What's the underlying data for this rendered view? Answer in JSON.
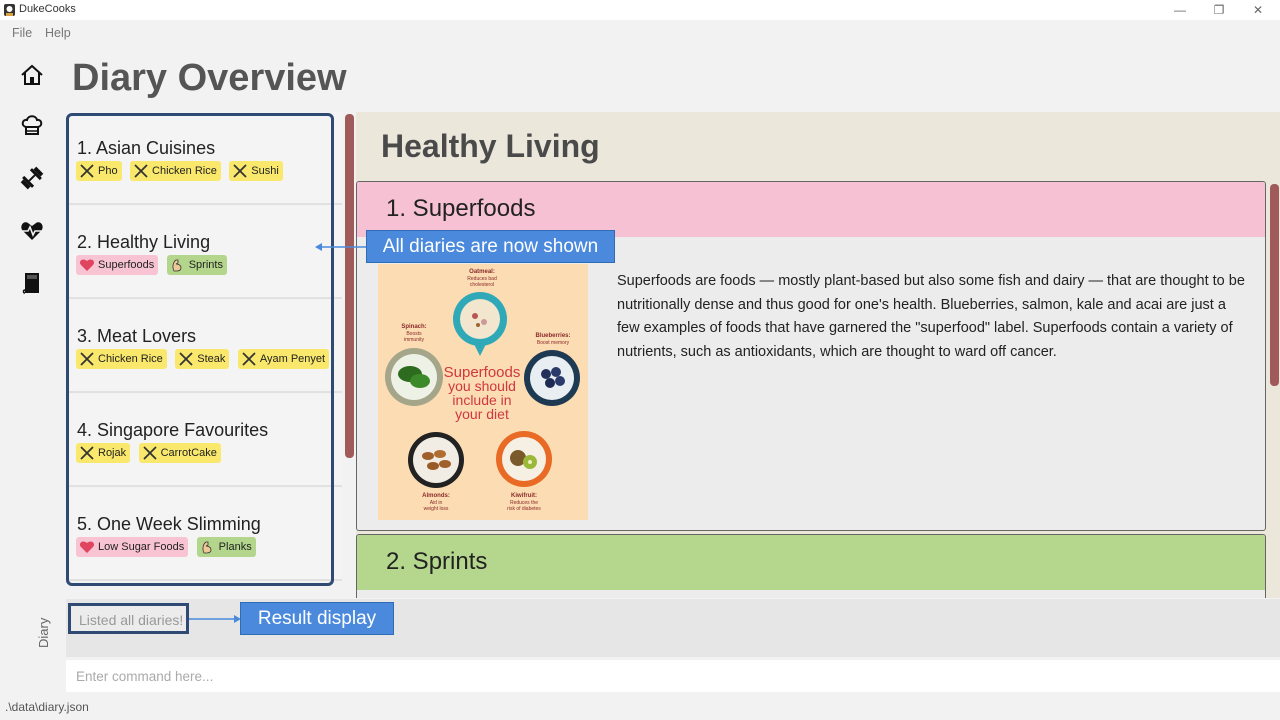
{
  "window": {
    "title": "DukeCooks",
    "controls": {
      "minimize": "—",
      "restore": "❐",
      "close": "✕"
    }
  },
  "menu": {
    "file": "File",
    "help": "Help"
  },
  "sidebar": {
    "icons": [
      "home-icon",
      "chef-hat-icon",
      "dumbbell-icon",
      "heartbeat-icon",
      "book-icon"
    ],
    "label": "Diary"
  },
  "page": {
    "title": "Diary Overview"
  },
  "diaries": [
    {
      "title": "1.  Asian Cuisines",
      "tags": [
        {
          "label": "Pho",
          "kind": "food"
        },
        {
          "label": "Chicken Rice",
          "kind": "food"
        },
        {
          "label": "Sushi",
          "kind": "food"
        }
      ]
    },
    {
      "title": "2.  Healthy Living",
      "tags": [
        {
          "label": "Superfoods",
          "kind": "heart"
        },
        {
          "label": "Sprints",
          "kind": "exercise"
        }
      ]
    },
    {
      "title": "3.  Meat Lovers",
      "tags": [
        {
          "label": "Chicken Rice",
          "kind": "food"
        },
        {
          "label": "Steak",
          "kind": "food"
        },
        {
          "label": "Ayam Penyet",
          "kind": "food"
        }
      ]
    },
    {
      "title": "4.  Singapore Favourites",
      "tags": [
        {
          "label": "Rojak",
          "kind": "food"
        },
        {
          "label": "CarrotCake",
          "kind": "food"
        }
      ]
    },
    {
      "title": "5.  One Week Slimming",
      "tags": [
        {
          "label": "Low Sugar Foods",
          "kind": "heart"
        },
        {
          "label": "Planks",
          "kind": "exercise"
        }
      ]
    }
  ],
  "detail": {
    "title": "Healthy Living",
    "pages": [
      {
        "header": "1. Superfoods",
        "header_color": "#f6c1d3",
        "body": "Superfoods are foods — mostly plant-based but also some fish and dairy — that are thought to be nutritionally dense and thus good for one's health. Blueberries, salmon, kale and acai are just a few examples of foods that have garnered the \"superfood\" label. Superfoods contain a variety of nutrients, such as antioxidants, which are thought to ward off cancer.",
        "image": {
          "headline": [
            "Superfoods",
            "you should",
            "include in",
            "your diet"
          ],
          "items": [
            {
              "name": "Oatmeal:",
              "desc": [
                "Reduces bad",
                "cholesterol"
              ]
            },
            {
              "name": "Spinach:",
              "desc": [
                "Boosts",
                "immunity"
              ]
            },
            {
              "name": "Blueberries:",
              "desc": [
                "Boost memory"
              ]
            },
            {
              "name": "Almonds:",
              "desc": [
                "Aid in",
                "weight loss"
              ]
            },
            {
              "name": "Kiwifruit:",
              "desc": [
                "Reduces the",
                "risk of diabetes"
              ]
            }
          ]
        }
      },
      {
        "header": "2. Sprints",
        "header_color": "#b5d78d"
      }
    ]
  },
  "result": {
    "text": "Listed all diaries!"
  },
  "command": {
    "placeholder": "Enter command here..."
  },
  "status": {
    "path": ".\\data\\diary.json"
  },
  "annotations": {
    "diaries_shown": "All diaries are now shown",
    "result_display": "Result display"
  },
  "colors": {
    "accent_border": "#2f4a73",
    "scrollbar": "#a05a5a",
    "callout": "#4a89dc",
    "tag_food": "#f9e86b",
    "tag_heart": "#f8c4d4",
    "tag_exercise": "#b3d68c"
  }
}
